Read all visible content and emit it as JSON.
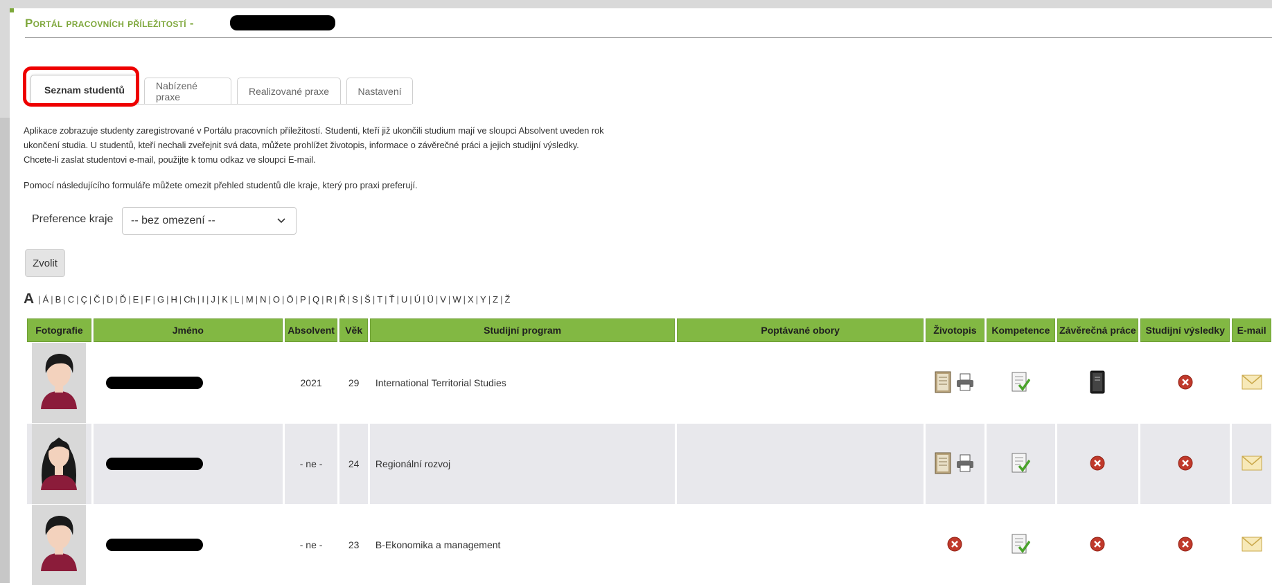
{
  "header": {
    "title": "Portál pracovních příležitostí -"
  },
  "tabs": [
    {
      "label": "Seznam studentů",
      "active": true
    },
    {
      "label": "Nabízené praxe",
      "active": false
    },
    {
      "label": "Realizované praxe",
      "active": false
    },
    {
      "label": "Nastavení",
      "active": false
    }
  ],
  "description": "Aplikace zobrazuje studenty zaregistrované v Portálu pracovních příležitostí. Studenti, kteří již ukončili studium mají ve sloupci Absolvent uveden rok ukončení studia. U studentů, kteří nechali zveřejnit svá data, můžete prohlížet životopis, informace o závěrečné práci a jejich studijní výsledky. Chcete-li zaslat studentovi e-mail, použijte k tomu odkaz ve sloupci E-mail.",
  "filter_note": "Pomocí následujícího formuláře můžete omezit přehled studentů dle kraje, který pro praxi preferují.",
  "filter": {
    "label": "Preference kraje",
    "selected": "-- bez omezení --",
    "submit": "Zvolit"
  },
  "alphabet": [
    "A",
    "Á",
    "B",
    "C",
    "Ç",
    "Č",
    "D",
    "Ď",
    "E",
    "F",
    "G",
    "H",
    "Ch",
    "I",
    "J",
    "K",
    "L",
    "M",
    "N",
    "O",
    "Ö",
    "P",
    "Q",
    "R",
    "Ř",
    "S",
    "Š",
    "T",
    "Ť",
    "U",
    "Ú",
    "Ü",
    "V",
    "W",
    "X",
    "Y",
    "Z",
    "Ž"
  ],
  "table": {
    "columns": [
      "Fotografie",
      "Jméno",
      "Absolvent",
      "Věk",
      "Studijní program",
      "Poptávané obory",
      "Životopis",
      "Kompetence",
      "Závěrečná práce",
      "Studijní výsledky",
      "E-mail"
    ],
    "rows": [
      {
        "gender": "male",
        "absolvent": "2021",
        "age": "29",
        "program": "International Territorial Studies",
        "obory": "",
        "cv": true,
        "thesis": true,
        "results": false
      },
      {
        "gender": "female",
        "absolvent": "- ne -",
        "age": "24",
        "program": "Regionální rozvoj",
        "obory": "",
        "cv": true,
        "thesis": false,
        "results": false
      },
      {
        "gender": "male",
        "absolvent": "- ne -",
        "age": "23",
        "program": "B-Ekonomika a management",
        "obory": "",
        "cv": false,
        "thesis": false,
        "results": false
      }
    ]
  },
  "colors": {
    "accent_green": "#82b843",
    "title_green": "#7ea73b",
    "highlight_red": "#ee0000",
    "row_alt": "#e8e8ec",
    "error_red": "#c0392b"
  }
}
